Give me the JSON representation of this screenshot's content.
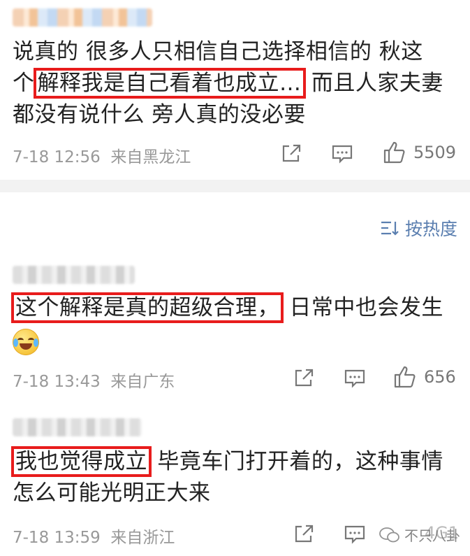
{
  "comments": [
    {
      "lines": [
        {
          "segments": [
            {
              "text": "说真的 很多人只相信自己选择相信的 秋这",
              "hl": false
            }
          ]
        },
        {
          "segments": [
            {
              "text": "个",
              "hl": false
            },
            {
              "text": "解释我是自己看着也成立…",
              "hl": true
            },
            {
              "text": " 而且人家夫妻",
              "hl": false
            }
          ]
        },
        {
          "segments": [
            {
              "text": "都没有说什么 旁人真的没必要",
              "hl": false
            }
          ]
        }
      ],
      "time": "7-18 12:56",
      "source": "来自黑龙江",
      "likes": "5509"
    },
    {
      "lines": [
        {
          "segments": [
            {
              "text": "这个解释是真的超级合理，",
              "hl": true
            },
            {
              "text": " 日常中也会发生",
              "hl": false
            }
          ]
        }
      ],
      "time": "7-18 13:43",
      "source": "来自广东",
      "likes": "656"
    },
    {
      "lines": [
        {
          "segments": [
            {
              "text": "我也觉得成立",
              "hl": true
            },
            {
              "text": "  毕竟车门打开着的，这种事情",
              "hl": false
            }
          ]
        },
        {
          "segments": [
            {
              "text": "怎么可能光明正大来",
              "hl": false
            }
          ]
        }
      ],
      "time": "7-18 13:59",
      "source": "来自浙江",
      "likes": "4G1"
    }
  ],
  "sort_label": "按热度",
  "watermark": "不只八卦",
  "colors": {
    "highlight": "#e81c1c",
    "meta": "#999999",
    "link": "#5b7fb0",
    "divider": "#f2f2f2"
  }
}
